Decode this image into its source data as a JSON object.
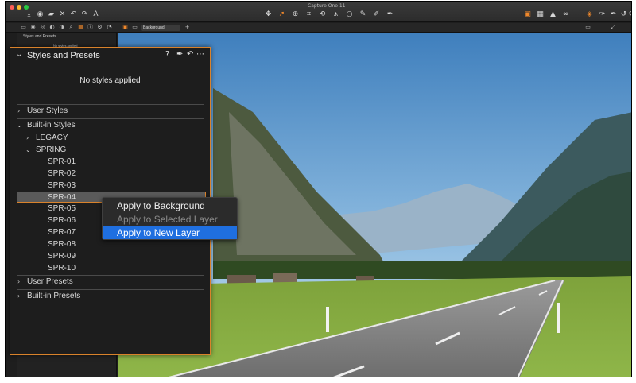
{
  "window": {
    "title": "Capture One 11"
  },
  "sidebar": {
    "title": "Styles and Presets",
    "status": "No styles applied"
  },
  "subbar": {
    "layer": "Background"
  },
  "panel": {
    "title": "Styles and Presets",
    "status": "No styles applied",
    "sections": [
      {
        "label": "User Styles",
        "expanded": false
      },
      {
        "label": "Built-in Styles",
        "expanded": true
      },
      {
        "label": "User Presets",
        "expanded": false
      },
      {
        "label": "Built-in Presets",
        "expanded": false
      }
    ],
    "builtin_groups": [
      {
        "label": "LEGACY",
        "expanded": false
      },
      {
        "label": "SPRING",
        "expanded": true
      }
    ],
    "spring_items": [
      "SPR-01",
      "SPR-02",
      "SPR-03",
      "SPR-04",
      "SPR-05",
      "SPR-06",
      "SPR-07",
      "SPR-08",
      "SPR-09",
      "SPR-10"
    ],
    "selected_item": "SPR-04"
  },
  "context_menu": {
    "items": [
      {
        "label": "Apply to Background",
        "state": "enabled"
      },
      {
        "label": "Apply to Selected Layer",
        "state": "disabled"
      },
      {
        "label": "Apply to New Layer",
        "state": "highlighted"
      }
    ]
  },
  "colors": {
    "accent": "#d9822b",
    "menu_highlight": "#1f6fe0",
    "panel_bg": "#1d1d1d"
  }
}
